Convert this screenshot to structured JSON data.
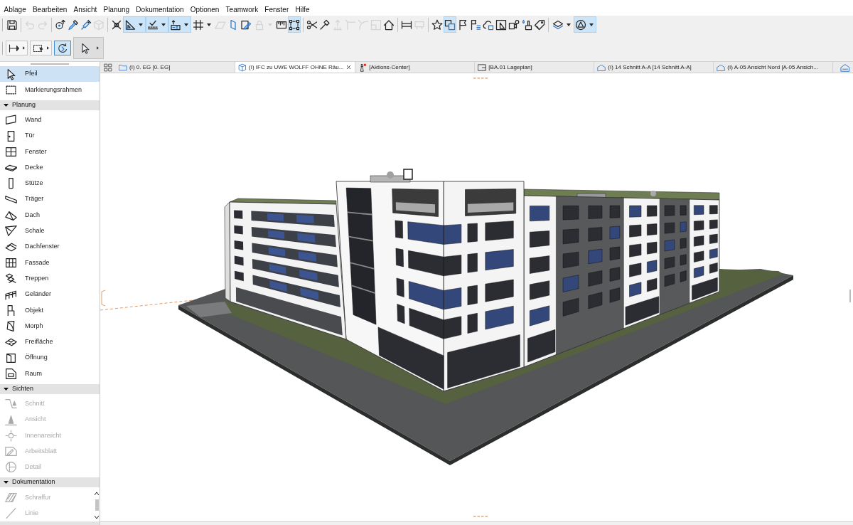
{
  "menu_bar": {
    "items": [
      "Ablage",
      "Bearbeiten",
      "Ansicht",
      "Planung",
      "Dokumentation",
      "Optionen",
      "Teamwork",
      "Fenster",
      "Hilfe"
    ]
  },
  "toolbar": {
    "items": [
      {
        "kind": "button",
        "selected": false,
        "disabled": false
      },
      {
        "kind": "separator"
      },
      {
        "kind": "button",
        "selected": false,
        "disabled": true
      },
      {
        "kind": "button",
        "selected": false,
        "disabled": true
      },
      {
        "kind": "separator"
      },
      {
        "kind": "button",
        "selected": false,
        "disabled": false
      },
      {
        "kind": "button",
        "selected": false,
        "disabled": false
      },
      {
        "kind": "button",
        "selected": false,
        "disabled": false
      },
      {
        "kind": "button",
        "selected": false,
        "disabled": true
      },
      {
        "kind": "separator"
      },
      {
        "kind": "button",
        "selected": false,
        "disabled": false
      },
      {
        "kind": "split",
        "selected": true,
        "disabled": false
      },
      {
        "kind": "split",
        "selected": true,
        "disabled": false
      },
      {
        "kind": "split",
        "selected": true,
        "disabled": false
      },
      {
        "kind": "split",
        "selected": false,
        "disabled": false
      },
      {
        "kind": "button",
        "selected": false,
        "disabled": true
      },
      {
        "kind": "button",
        "selected": false,
        "disabled": false
      },
      {
        "kind": "button",
        "selected": false,
        "disabled": false
      },
      {
        "kind": "split",
        "selected": false,
        "disabled": true
      },
      {
        "kind": "button",
        "selected": false,
        "disabled": false
      },
      {
        "kind": "button",
        "selected": true,
        "disabled": false
      },
      {
        "kind": "separator"
      },
      {
        "kind": "button",
        "selected": false,
        "disabled": false
      },
      {
        "kind": "button",
        "selected": false,
        "disabled": false
      },
      {
        "kind": "button",
        "selected": false,
        "disabled": true
      },
      {
        "kind": "button",
        "selected": false,
        "disabled": true
      },
      {
        "kind": "button",
        "selected": false,
        "disabled": true
      },
      {
        "kind": "button",
        "selected": false,
        "disabled": true
      },
      {
        "kind": "button",
        "selected": false,
        "disabled": false
      },
      {
        "kind": "separator"
      },
      {
        "kind": "button",
        "selected": false,
        "disabled": false
      },
      {
        "kind": "button",
        "selected": false,
        "disabled": true
      },
      {
        "kind": "separator"
      },
      {
        "kind": "button",
        "selected": false,
        "disabled": false
      },
      {
        "kind": "button",
        "selected": true,
        "disabled": false
      },
      {
        "kind": "button",
        "selected": false,
        "disabled": false
      },
      {
        "kind": "button",
        "selected": false,
        "disabled": false
      },
      {
        "kind": "button",
        "selected": false,
        "disabled": false
      },
      {
        "kind": "button",
        "selected": false,
        "disabled": false
      },
      {
        "kind": "button",
        "selected": false,
        "disabled": false
      },
      {
        "kind": "button",
        "selected": false,
        "disabled": false
      },
      {
        "kind": "button",
        "selected": false,
        "disabled": false
      },
      {
        "kind": "separator"
      },
      {
        "kind": "split",
        "selected": false,
        "disabled": false
      },
      {
        "kind": "split",
        "selected": true,
        "disabled": false
      }
    ]
  },
  "option_bar": {
    "items": [
      {
        "kind": "flyout",
        "selected": false
      },
      {
        "kind": "flyout",
        "selected": false
      },
      {
        "kind": "button",
        "selected": true
      },
      {
        "kind": "flyout_panel",
        "selected": false
      }
    ]
  },
  "tabs": [
    {
      "kind": "floor_plan",
      "label": "(I) 0. EG [0. EG]",
      "selected": false
    },
    {
      "kind": "model",
      "label": "(I) IFC zu UWE WOLFF OHNE Räu...",
      "selected": true
    },
    {
      "kind": "action_center",
      "label": "[Aktions-Center]",
      "selected": false
    },
    {
      "kind": "layout",
      "label": "[BA.01 Lageplan]",
      "selected": false
    },
    {
      "kind": "section",
      "label": "(I) 14 Schnitt A-A [14 Schnitt A-A]",
      "selected": false
    },
    {
      "kind": "elevation",
      "label": "(I) A-05 Ansicht Nord [A-05 Ansich...",
      "selected": false
    }
  ],
  "toolbox": {
    "tools": [
      {
        "label": "Pfeil",
        "selected": true,
        "disabled": false
      },
      {
        "label": "Markierungsrahmen",
        "selected": false,
        "disabled": false
      }
    ],
    "sections": [
      {
        "title": "Planung",
        "expanded": true,
        "tools": [
          {
            "label": "Wand",
            "selected": false,
            "disabled": false
          },
          {
            "label": "Tür",
            "selected": false,
            "disabled": false
          },
          {
            "label": "Fenster",
            "selected": false,
            "disabled": false
          },
          {
            "label": "Decke",
            "selected": false,
            "disabled": false
          },
          {
            "label": "Stütze",
            "selected": false,
            "disabled": false
          },
          {
            "label": "Träger",
            "selected": false,
            "disabled": false
          },
          {
            "label": "Dach",
            "selected": false,
            "disabled": false
          },
          {
            "label": "Schale",
            "selected": false,
            "disabled": false
          },
          {
            "label": "Dachfenster",
            "selected": false,
            "disabled": false
          },
          {
            "label": "Fassade",
            "selected": false,
            "disabled": false
          },
          {
            "label": "Treppen",
            "selected": false,
            "disabled": false
          },
          {
            "label": "Geländer",
            "selected": false,
            "disabled": false
          },
          {
            "label": "Objekt",
            "selected": false,
            "disabled": false
          },
          {
            "label": "Morph",
            "selected": false,
            "disabled": false
          },
          {
            "label": "Freifläche",
            "selected": false,
            "disabled": false
          },
          {
            "label": "Öffnung",
            "selected": false,
            "disabled": false
          },
          {
            "label": "Raum",
            "selected": false,
            "disabled": false
          }
        ]
      },
      {
        "title": "Sichten",
        "expanded": true,
        "tools": [
          {
            "label": "Schnitt",
            "selected": false,
            "disabled": true
          },
          {
            "label": "Ansicht",
            "selected": false,
            "disabled": true
          },
          {
            "label": "Innenansicht",
            "selected": false,
            "disabled": true
          },
          {
            "label": "Arbeitsblatt",
            "selected": false,
            "disabled": true
          },
          {
            "label": "Detail",
            "selected": false,
            "disabled": true
          }
        ]
      },
      {
        "title": "Dokumentation",
        "expanded": true,
        "tools": [
          {
            "label": "Schraffur",
            "selected": false,
            "disabled": true
          },
          {
            "label": "Linie",
            "selected": false,
            "disabled": true
          }
        ]
      }
    ]
  }
}
